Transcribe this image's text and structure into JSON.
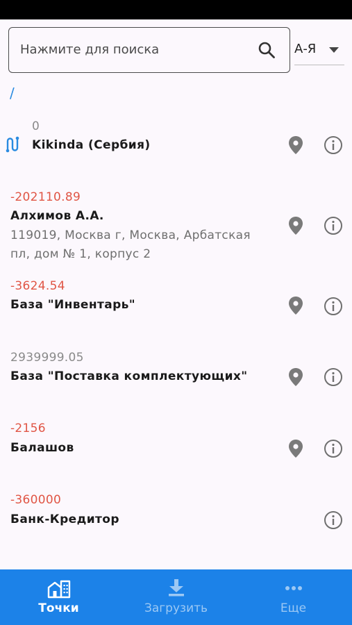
{
  "search": {
    "placeholder": "Нажмите для поиска"
  },
  "sort": {
    "label": "А-Я"
  },
  "breadcrumb": "/",
  "items": [
    {
      "balance": "0",
      "name": "Kikinda (Сербия)",
      "address": ""
    },
    {
      "balance": "-202110.89",
      "name": "Алхимов А.А.",
      "address_line1": "119019, Москва г, Москва, Арбатская",
      "address_line2": "пл, дом № 1, корпус 2"
    },
    {
      "balance": "-3624.54",
      "name": "База \"Инвентарь\""
    },
    {
      "balance": "2939999.05",
      "name": "База \"Поставка комплектующих\""
    },
    {
      "balance": "-2156",
      "name": "Балашов"
    },
    {
      "balance": "-360000",
      "name": "Банк-Кредитор"
    }
  ],
  "tabs": [
    {
      "label": "Точки",
      "icon": "buildings-icon",
      "active": true
    },
    {
      "label": "Загрузить",
      "icon": "download-icon",
      "active": false
    },
    {
      "label": "Еще",
      "icon": "more-icon",
      "active": false
    }
  ],
  "colors": {
    "accent": "#1c82e8",
    "negative": "#e05545",
    "link": "#2a8be0"
  }
}
